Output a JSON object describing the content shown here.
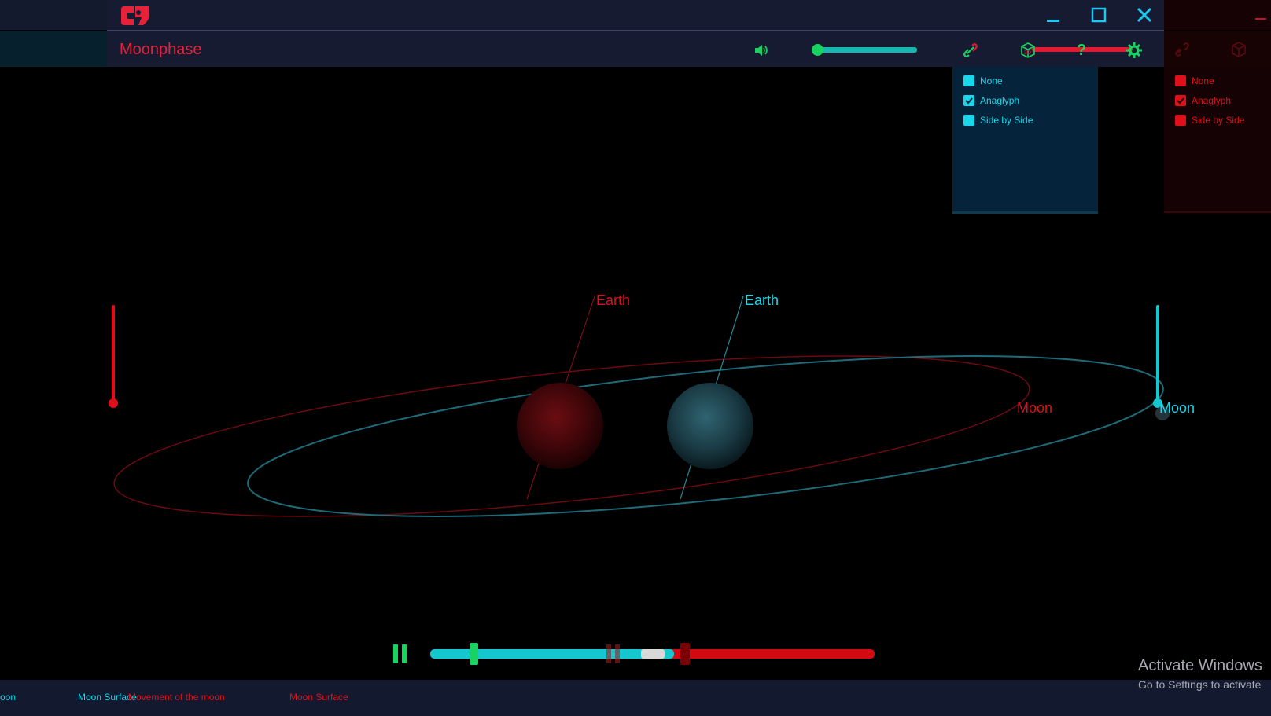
{
  "app": {
    "title": "Moonphase",
    "logo_icon": "app-logo-icon",
    "accent_red": "#e8213a",
    "accent_cyan": "#14c8d0",
    "accent_green": "#18d35f"
  },
  "window_controls": {
    "minimize_icon": "minimize-icon",
    "maximize_icon": "maximize-icon",
    "close_icon": "close-icon"
  },
  "toolbar": {
    "volume_icon": "speaker-icon",
    "volume_level": 0.0,
    "link_icon": "link-icon",
    "stereo_icon": "3d-cube-icon",
    "help_label": "?",
    "settings_icon": "gear-icon"
  },
  "stereo_menu_cyan": {
    "options": [
      {
        "label": "None",
        "checked": false
      },
      {
        "label": "Anaglyph",
        "checked": true
      },
      {
        "label": "Side by Side",
        "checked": false
      }
    ]
  },
  "stereo_menu_red": {
    "options": [
      {
        "label": "None",
        "checked": false
      },
      {
        "label": "Anaglyph",
        "checked": true
      },
      {
        "label": "Side by Side",
        "checked": false
      }
    ]
  },
  "scene": {
    "earth_label_red": "Earth",
    "earth_label_cyan": "Earth",
    "moon_label_red": "Moon",
    "moon_label_cyan": "Moon"
  },
  "playback": {
    "pause_icon": "pause-icon",
    "progress": 0.1
  },
  "bottom_tabs": {
    "cyan": [
      "oon",
      "Moon Surface"
    ],
    "red": [
      "Movement of the moon",
      "Moon Surface"
    ]
  },
  "watermark": {
    "line1": "Activate Windows",
    "line2": "Go to Settings to activate"
  }
}
